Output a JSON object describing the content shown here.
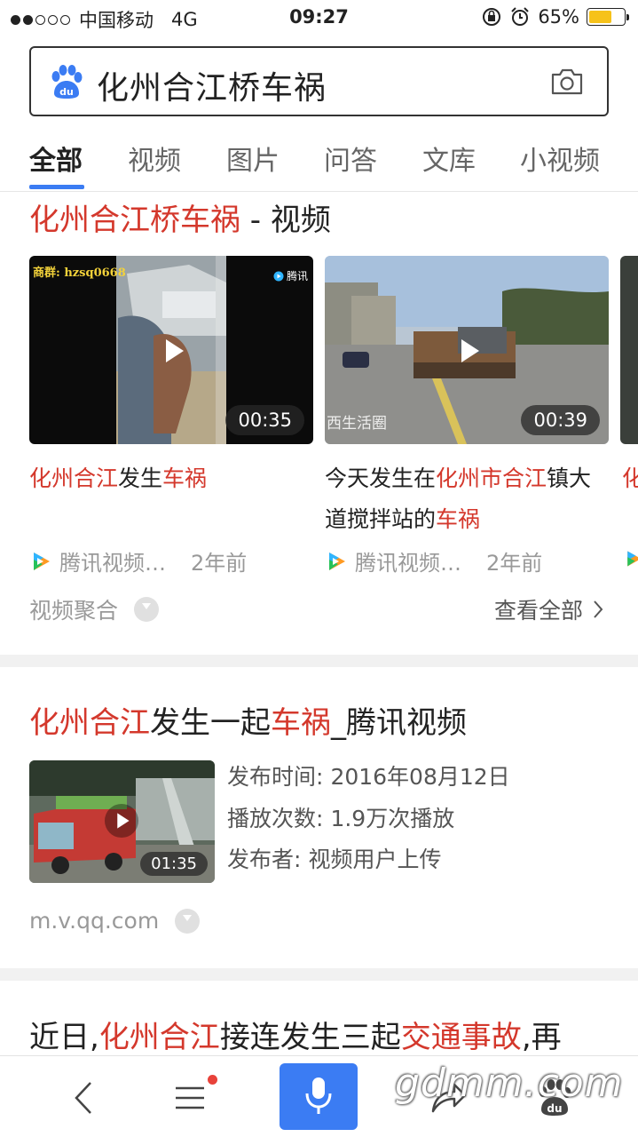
{
  "status_bar": {
    "carrier": "中国移动",
    "network": "4G",
    "time": "09:27",
    "battery_percent": "65%",
    "battery_level": 0.65
  },
  "search": {
    "query": "化州合江桥车祸"
  },
  "tabs": [
    {
      "label": "全部",
      "active": true
    },
    {
      "label": "视频",
      "active": false
    },
    {
      "label": "图片",
      "active": false
    },
    {
      "label": "问答",
      "active": false
    },
    {
      "label": "文库",
      "active": false
    },
    {
      "label": "小视频",
      "active": false
    }
  ],
  "video_section": {
    "title_highlight": "化州合江桥车祸",
    "title_suffix": " - 视频",
    "cards": [
      {
        "duration": "00:35",
        "overlay_text": "商群: hzsq0668",
        "overlay_brand": "腾讯",
        "title_parts": [
          {
            "text": "化州合江",
            "hl": true
          },
          {
            "text": "发生",
            "hl": false
          },
          {
            "text": "车祸",
            "hl": true
          }
        ],
        "source": "腾讯视频…",
        "age": "2年前"
      },
      {
        "duration": "00:39",
        "overlay_text": "西生活圈",
        "title_parts": [
          {
            "text": "今天发生在",
            "hl": false
          },
          {
            "text": "化州市合江",
            "hl": true
          },
          {
            "text": "镇大道搅拌站的",
            "hl": false
          },
          {
            "text": "车祸",
            "hl": true
          }
        ],
        "source": "腾讯视频…",
        "age": "2年前"
      },
      {
        "title_parts": [
          {
            "text": "化",
            "hl": true
          }
        ]
      }
    ],
    "aggregate_label": "视频聚合",
    "view_all_label": "查看全部"
  },
  "result2": {
    "title_parts": [
      {
        "text": "化州合江",
        "hl": true
      },
      {
        "text": "发生一起",
        "hl": false
      },
      {
        "text": "车祸",
        "hl": true
      },
      {
        "text": "_腾讯视频",
        "hl": false
      }
    ],
    "duration": "01:35",
    "meta": [
      {
        "label": "发布时间:",
        "value": "2016年08月12日"
      },
      {
        "label": "播放次数:",
        "value": "1.9万次播放"
      },
      {
        "label": "发布者:",
        "value": "视频用户上传"
      }
    ],
    "domain": "m.v.qq.com"
  },
  "result3": {
    "title_parts": [
      {
        "text": "近日,",
        "hl": false
      },
      {
        "text": "化州合江",
        "hl": true
      },
      {
        "text": "接连发生三起",
        "hl": false
      },
      {
        "text": "交通事故",
        "hl": true
      },
      {
        "text": ",再",
        "hl": false
      }
    ]
  },
  "bottom_bar": {
    "items": [
      "back-icon",
      "menu-icon",
      "mic-icon",
      "share-icon",
      "baidu-home-icon"
    ]
  },
  "watermark": "gdmm.com",
  "colors": {
    "highlight_red": "#d4382c",
    "accent_blue": "#3b7cf3",
    "battery_yellow": "#f6c21a"
  }
}
